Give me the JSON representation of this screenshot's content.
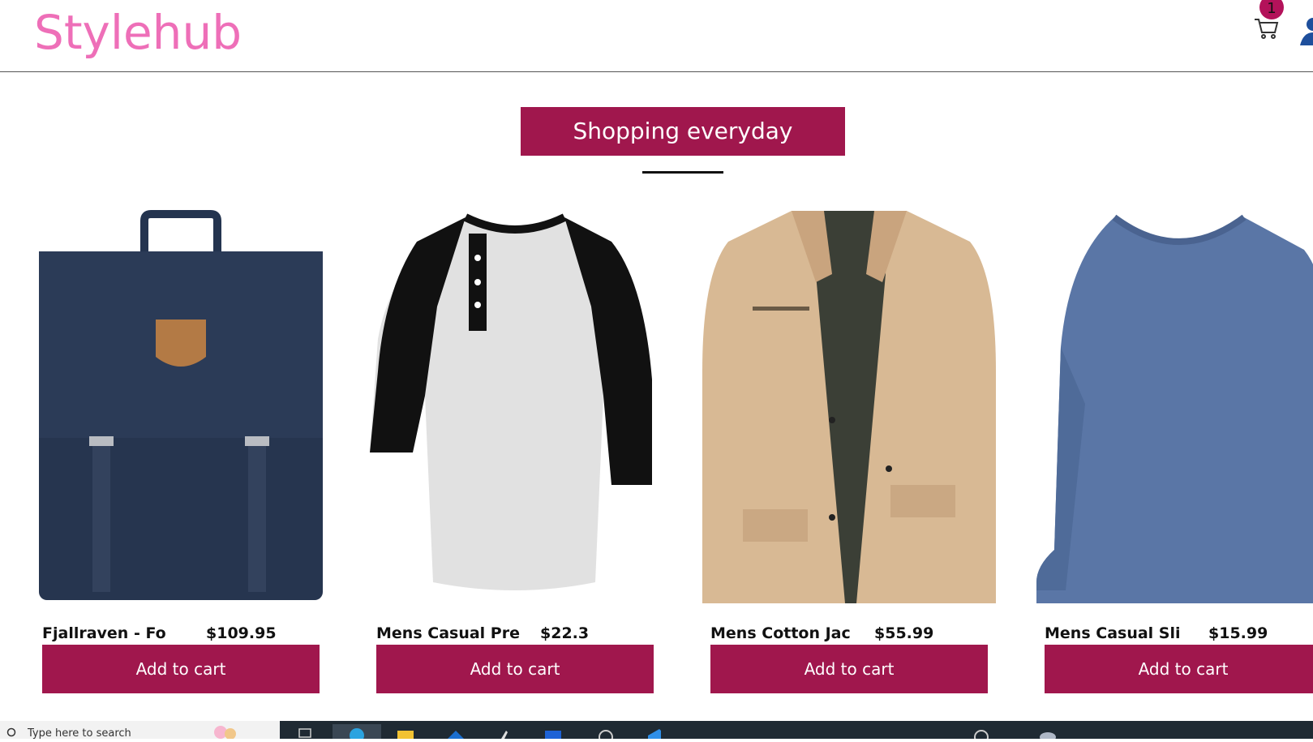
{
  "header": {
    "logo": "Stylehub",
    "cart_count": "1"
  },
  "hero": {
    "title": "Shopping everyday"
  },
  "products": [
    {
      "name": "Fjallraven - Fo",
      "price": "$109.95",
      "button": "Add to cart",
      "image": "backpack"
    },
    {
      "name": "Mens Casual Pre",
      "price": "$22.3",
      "button": "Add to cart",
      "image": "raglan-tshirt"
    },
    {
      "name": "Mens Cotton Jac",
      "price": "$55.99",
      "button": "Add to cart",
      "image": "cotton-jacket"
    },
    {
      "name": "Mens Casual Sli",
      "price": "$15.99",
      "button": "Add to cart",
      "image": "long-sleeve-tee"
    }
  ],
  "taskbar": {
    "search_placeholder": "Type here to search"
  },
  "colors": {
    "brand_pink": "#ee6fb8",
    "accent": "#a0174d",
    "badge": "#b3125a",
    "taskbar": "#1f2a33"
  }
}
